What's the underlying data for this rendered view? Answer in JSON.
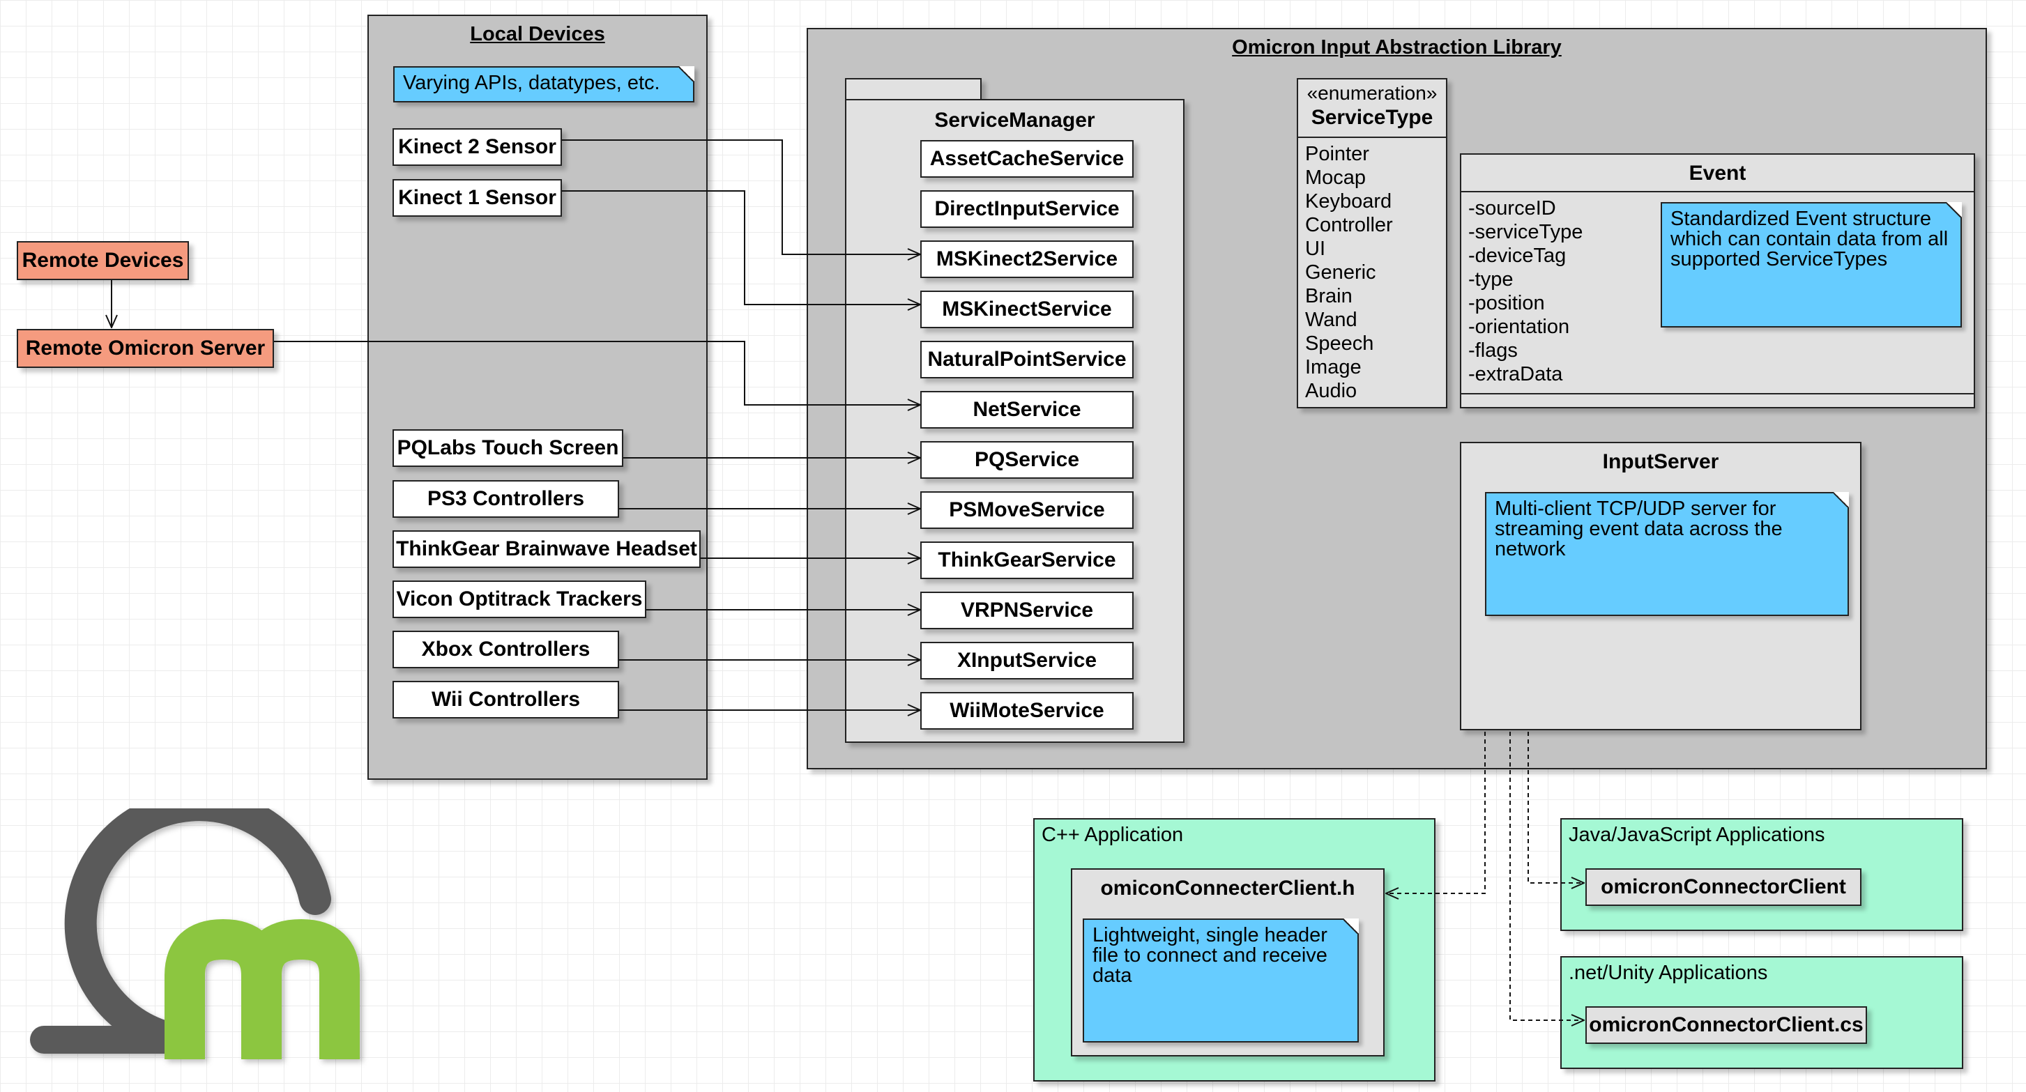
{
  "local_devices": {
    "title": "Local Devices",
    "note": "Varying APIs, datatypes, etc.",
    "devices": [
      "Kinect 2 Sensor",
      "Kinect 1 Sensor",
      "PQLabs Touch Screen",
      "PS3 Controllers",
      "ThinkGear Brainwave Headset",
      "Vicon Optitrack Trackers",
      "Xbox Controllers",
      "Wii Controllers"
    ]
  },
  "remote": {
    "devices": "Remote Devices",
    "server": "Remote Omicron Server"
  },
  "library": {
    "title": "Omicron Input Abstraction Library",
    "service_manager": {
      "title": "ServiceManager",
      "services": [
        "AssetCacheService",
        "DirectInputService",
        "MSKinect2Service",
        "MSKinectService",
        "NaturalPointService",
        "NetService",
        "PQService",
        "PSMoveService",
        "ThinkGearService",
        "VRPNService",
        "XInputService",
        "WiiMoteService"
      ]
    },
    "service_type": {
      "stereotype": "«enumeration»",
      "name": "ServiceType",
      "values": [
        "Pointer",
        "Mocap",
        "Keyboard",
        "Controller",
        "UI",
        "Generic",
        "Brain",
        "Wand",
        "Speech",
        "Image",
        "Audio"
      ]
    },
    "event": {
      "title": "Event",
      "fields": [
        "-sourceID",
        "-serviceType",
        "-deviceTag",
        "-type",
        "-position",
        "-orientation",
        "-flags",
        "-extraData"
      ],
      "note": "Standardized Event structure\nwhich can contain data from all\nsupported ServiceTypes"
    },
    "input_server": {
      "title": "InputServer",
      "note": "Multi-client TCP/UDP server for\nstreaming event data across the\nnetwork"
    }
  },
  "cpp_app": {
    "title": "C++ Application",
    "class_name": "omiconConnecterClient.h",
    "note": "Lightweight, single header\nfile to connect and receive\ndata"
  },
  "java_app": {
    "title": "Java/JavaScript Applications",
    "client": "omicronConnectorClient"
  },
  "net_app": {
    "title": ".net/Unity Applications",
    "client": "omicronConnectorClient.cs"
  },
  "colors": {
    "container": "#c3c3c3",
    "light_box": "#e1e1e1",
    "note": "#66ccff",
    "remote": "#f59b7f",
    "app_area": "#a5f8d4",
    "logo_gray": "#5a5a5a",
    "logo_green": "#8cc63f"
  },
  "icons": {
    "logo": "omicron-logo-icon"
  }
}
